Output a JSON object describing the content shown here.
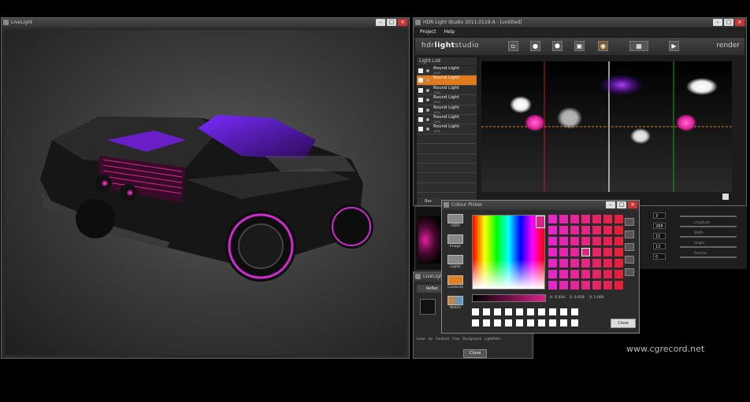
{
  "live_view": {
    "title": "LiveLight"
  },
  "hdr_window": {
    "title": "HDR Light Studio 2011.0119.A - [untitled]",
    "menu": [
      "Project",
      "Help"
    ],
    "logo_prefix": "hdr",
    "logo_bold": "light",
    "logo_suffix": "studio",
    "render_label": "render",
    "light_list_label": "Light List",
    "lights": [
      {
        "name": "Round Light",
        "sub": "1000",
        "selected": false
      },
      {
        "name": "Round Light",
        "sub": "1000",
        "selected": true
      },
      {
        "name": "Round Light",
        "sub": "1000",
        "selected": false
      },
      {
        "name": "Round Light",
        "sub": "1000",
        "selected": false
      },
      {
        "name": "Round Light",
        "sub": "1000",
        "selected": false
      },
      {
        "name": "Round Light",
        "sub": "1000",
        "selected": false
      },
      {
        "name": "Round Light",
        "sub": "1000",
        "selected": false
      }
    ],
    "background_label": "Bac",
    "canvas_labels": {
      "blur": "Blur",
      "history": "History"
    }
  },
  "properties": {
    "values": [
      "3",
      "288",
      "15",
      "13",
      "0"
    ],
    "slider_labels": [
      "Longitude",
      "Width",
      "Height",
      "Rotation"
    ]
  },
  "bottom_panel": {
    "title": "LiveLight",
    "tabs": [
      "Reflec"
    ],
    "labels": [
      "Level",
      "Up",
      "Contrast",
      "Flow",
      "Background",
      "LightPaint"
    ],
    "close_label": "Close"
  },
  "colour_picker": {
    "title": "Colour Picker",
    "side_buttons": [
      "HDRI",
      "Image",
      "Lights",
      "Contents",
      "Watch"
    ],
    "hsv": {
      "h": "H: 0.934",
      "s": "S: 0.918",
      "v": "V: 1.000"
    },
    "close_label": "Close",
    "grid_colors": [
      "#e626c8",
      "#e626b0",
      "#e62698",
      "#e62680",
      "#e62468",
      "#e62250",
      "#e62038",
      "#e626c8",
      "#e626b0",
      "#e62698",
      "#e62680",
      "#e62468",
      "#e62250",
      "#e62038",
      "#e626c8",
      "#e626b0",
      "#e62698",
      "#e62680",
      "#e62468",
      "#e62250",
      "#e62038",
      "#e626c8",
      "#e626b0",
      "#e62698",
      "#e62680",
      "#e62468",
      "#e62250",
      "#e62038",
      "#e626c8",
      "#e626b0",
      "#e62698",
      "#e62680",
      "#e62468",
      "#e62250",
      "#e62038",
      "#e626c8",
      "#e626b0",
      "#e62698",
      "#e62680",
      "#e62468",
      "#e62250",
      "#e62038",
      "#e626c8",
      "#e626b0",
      "#e62698",
      "#e62680",
      "#e62468",
      "#e62250",
      "#e62038"
    ],
    "selected_cell": 24
  },
  "watermark": "www.cgrecord.net"
}
